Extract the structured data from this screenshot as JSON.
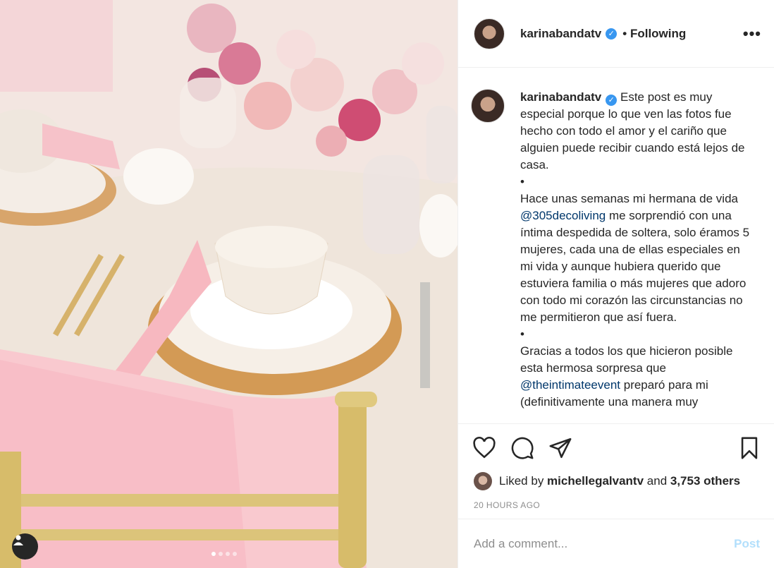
{
  "post": {
    "username": "karinabandatv",
    "verified": true,
    "follow_status": "Following",
    "more_label": "•••",
    "image_alt": "Table setting with pink napkins and gold polka-dot plates",
    "carousel": {
      "count": 4,
      "active": 1
    }
  },
  "caption": {
    "username": "karinabandatv",
    "part1": " Este post es muy especial porque lo que ven las fotos fue hecho con todo el amor y el cariño que alguien puede recibir cuando está lejos de casa.",
    "bullet1": "•",
    "part2a": "Hace unas semanas mi hermana de vida ",
    "mention1": "@305decoliving",
    "part2b": " me sorprendió con una íntima despedida de soltera, solo éramos 5 mujeres, cada una de ellas especiales en mi vida y aunque hubiera querido que estuviera familia o más mujeres que adoro con todo mi corazón las circunstancias no me permitieron que así fuera.",
    "bullet2": "•",
    "part3a": "Gracias a todos los que hicieron posible esta hermosa sorpresa que ",
    "mention2": "@theintimateevent",
    "part3b": " preparó para mi (definitivamente una manera muy"
  },
  "likes": {
    "prefix": "Liked by ",
    "user": "michellegalvantv",
    "middle": " and ",
    "others": "3,753 others"
  },
  "timestamp": "20 HOURS AGO",
  "comment": {
    "placeholder": "Add a comment...",
    "post_label": "Post"
  },
  "icons": [
    "heart-icon",
    "comment-icon",
    "share-icon",
    "bookmark-icon",
    "user-tag-icon"
  ],
  "colors": {
    "link": "#00376b",
    "verified": "#3897f0",
    "post_disabled": "#b2dffc",
    "meta": "#8e8e8e"
  }
}
